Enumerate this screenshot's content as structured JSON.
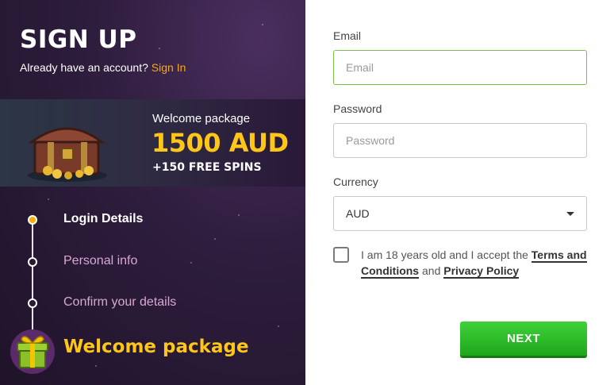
{
  "header": {
    "title": "SIGN UP",
    "signin_prompt": "Already have an account?",
    "signin_link": "Sign In"
  },
  "banner": {
    "label": "Welcome package",
    "amount": "1500 AUD",
    "spins": "+150 FREE SPINS"
  },
  "steps": [
    {
      "label": "Login Details",
      "state": "active"
    },
    {
      "label": "Personal info",
      "state": "inactive"
    },
    {
      "label": "Confirm your details",
      "state": "inactive"
    }
  ],
  "final_step": {
    "label": "Welcome package",
    "icon": "gift-icon"
  },
  "form": {
    "email": {
      "label": "Email",
      "placeholder": "Email",
      "value": ""
    },
    "password": {
      "label": "Password",
      "placeholder": "Password",
      "value": ""
    },
    "currency": {
      "label": "Currency",
      "selected": "AUD"
    },
    "terms": {
      "prefix": "I am 18 years old and I accept the",
      "terms_link": "Terms and Conditions",
      "conjunction": "and",
      "privacy_link": "Privacy Policy"
    },
    "next_label": "NEXT"
  },
  "colors": {
    "accent_yellow": "#ffc61a",
    "signin_orange": "#f5a623",
    "next_green": "#2bbd27",
    "focus_green": "#7cc04b",
    "panel_purple": "#2e1d3d"
  }
}
